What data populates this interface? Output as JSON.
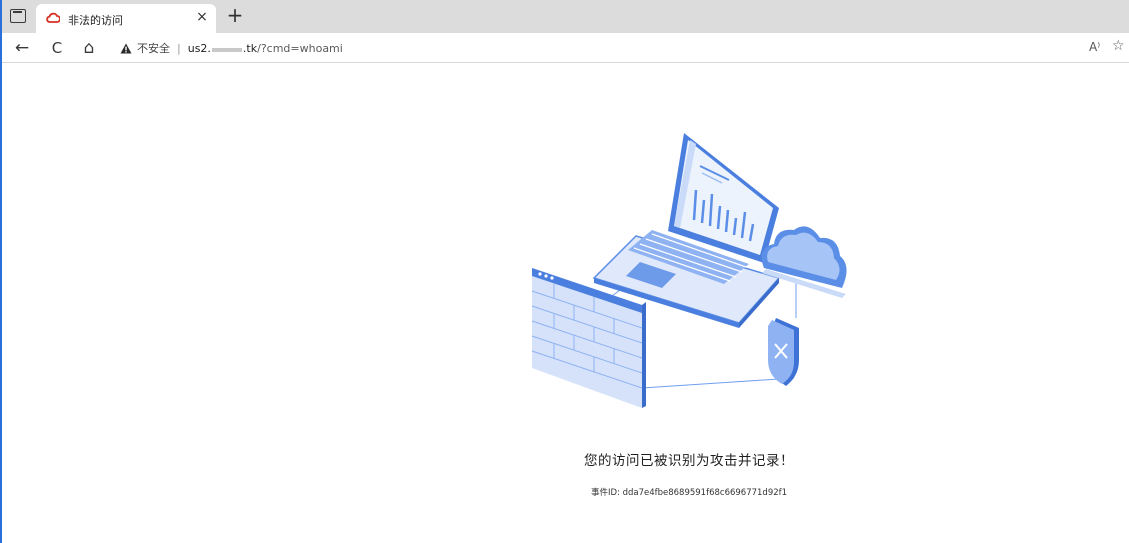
{
  "browser": {
    "tab": {
      "title": "非法的访问",
      "close_glyph": "×"
    },
    "new_tab_glyph": "+",
    "nav": {
      "back_glyph": "←",
      "refresh_glyph": "C",
      "home_glyph": "⌂"
    },
    "address": {
      "security_label": "不安全",
      "separator": "|",
      "host_prefix": "us2.",
      "host_suffix": ".tk",
      "path": "/?cmd=whoami"
    },
    "right_icons": {
      "read_aloud": "A⁾",
      "favorites": "☆"
    }
  },
  "page": {
    "message": "您的访问已被识别为攻击并记录！",
    "event_id": "事件ID: dda7e4fbe8689591f68c6696771d92f1"
  },
  "colors": {
    "accent": "#4a86e8",
    "window_border": "#2b6fd8",
    "favicon": "#d93025"
  }
}
